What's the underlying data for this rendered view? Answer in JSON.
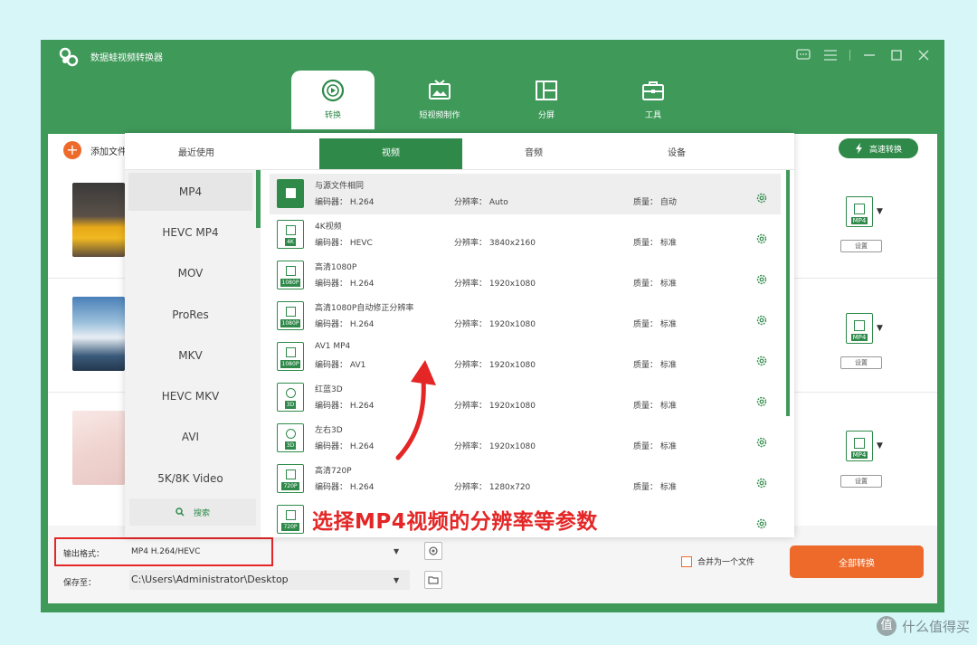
{
  "app": {
    "title": "数据蛙视频转换器"
  },
  "nav_tabs": [
    {
      "label": "转换",
      "icon": "convert-icon",
      "active": true
    },
    {
      "label": "短视频制作",
      "icon": "tv-icon",
      "active": false
    },
    {
      "label": "分屏",
      "icon": "split-screen-icon",
      "active": false
    },
    {
      "label": "工具",
      "icon": "toolbox-icon",
      "active": false
    }
  ],
  "toolbar": {
    "add_file_label": "添加文件",
    "fast_convert_label": "高速转换"
  },
  "file_rows": [
    {
      "format_tag": "MP4",
      "settings_label": "设置"
    },
    {
      "format_tag": "MP4",
      "settings_label": "设置"
    },
    {
      "format_tag": "MP4",
      "settings_label": "设置"
    }
  ],
  "popup": {
    "tabs": [
      {
        "label": "最近使用",
        "active": false
      },
      {
        "label": "视频",
        "active": true
      },
      {
        "label": "音频",
        "active": false
      },
      {
        "label": "设备",
        "active": false
      }
    ],
    "formats": [
      "MP4",
      "HEVC MP4",
      "MOV",
      "ProRes",
      "MKV",
      "HEVC MKV",
      "AVI",
      "5K/8K Video"
    ],
    "search_label": "搜索",
    "presets": [
      {
        "name": "与源文件相同",
        "encoder": "编码器：  H.264",
        "resolution": "分辨率：  Auto",
        "quality": "质量：  自动",
        "tag": ""
      },
      {
        "name": "4K视频",
        "encoder": "编码器：  HEVC",
        "resolution": "分辨率：  3840x2160",
        "quality": "质量：  标准",
        "tag": "4K"
      },
      {
        "name": "高清1080P",
        "encoder": "编码器：  H.264",
        "resolution": "分辨率：  1920x1080",
        "quality": "质量：  标准",
        "tag": "1080P"
      },
      {
        "name": "高清1080P自动修正分辨率",
        "encoder": "编码器：  H.264",
        "resolution": "分辨率：  1920x1080",
        "quality": "质量：  标准",
        "tag": "1080P"
      },
      {
        "name": "AV1 MP4",
        "encoder": "编码器：  AV1",
        "resolution": "分辨率：  1920x1080",
        "quality": "质量：  标准",
        "tag": "1080P"
      },
      {
        "name": "红蓝3D",
        "encoder": "编码器：  H.264",
        "resolution": "分辨率：  1920x1080",
        "quality": "质量：  标准",
        "tag": "3D"
      },
      {
        "name": "左右3D",
        "encoder": "编码器：  H.264",
        "resolution": "分辨率：  1920x1080",
        "quality": "质量：  标准",
        "tag": "3D"
      },
      {
        "name": "高清720P",
        "encoder": "编码器：  H.264",
        "resolution": "分辨率：  1280x720",
        "quality": "质量：  标准",
        "tag": "720P"
      },
      {
        "name": "",
        "encoder": "",
        "resolution": "",
        "quality": "",
        "tag": "720P"
      }
    ]
  },
  "annotation": "选择MP4视频的分辨率等参数",
  "bottom": {
    "output_format_label": "输出格式：",
    "output_format_value": "MP4 H.264/HEVC",
    "save_to_label": "保存至：",
    "save_to_value": "C:\\Users\\Administrator\\Desktop",
    "merge_label": "合并为一个文件",
    "convert_all_label": "全部转换"
  },
  "watermark": "什么值得买",
  "colors": {
    "brand_green": "#3f9a5a",
    "accent_orange": "#ee6a2b",
    "annotation_red": "#e42626"
  }
}
